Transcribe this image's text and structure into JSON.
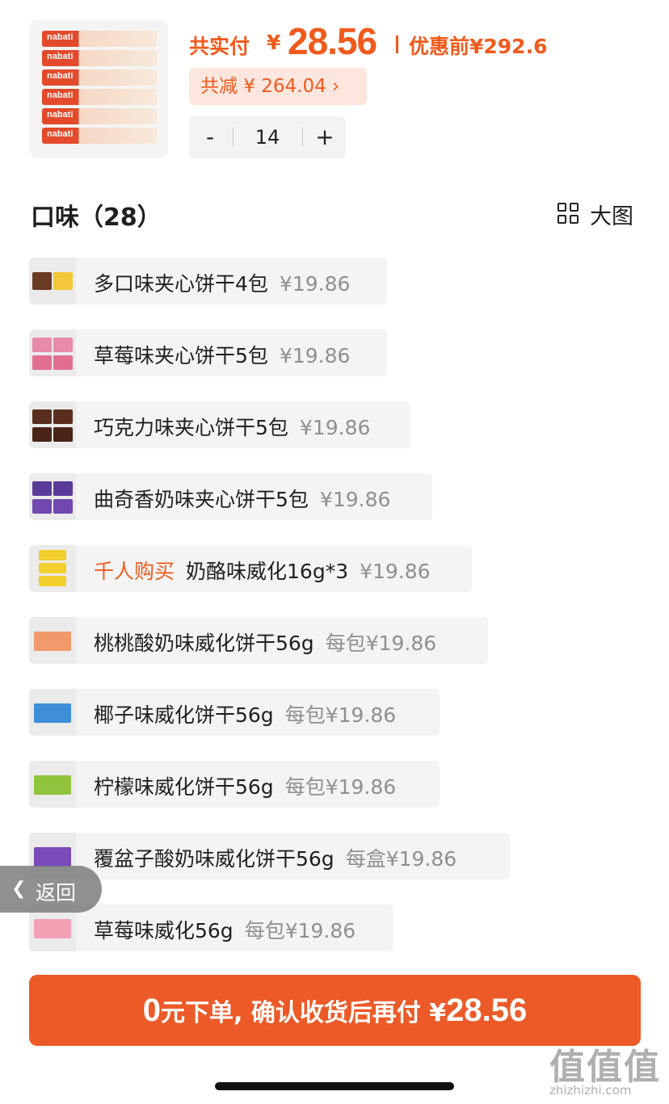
{
  "header": {
    "paid_label": "共实付",
    "currency": "¥",
    "paid_amount": "28.56",
    "original_label": "优惠前¥292.6",
    "discount_label": "共减 ¥ 264.04 ›",
    "quantity": "14",
    "minus_label": "-",
    "plus_label": "+",
    "product_brand": "nabati"
  },
  "section": {
    "title": "口味（28）",
    "view_label": "大图"
  },
  "options": [
    {
      "name": "多口味夹心饼干4包",
      "price": "¥19.86"
    },
    {
      "name": "草莓味夹心饼干5包",
      "price": "¥19.86"
    },
    {
      "name": "巧克力味夹心饼干5包",
      "price": "¥19.86"
    },
    {
      "name": "曲奇香奶味夹心饼干5包",
      "price": "¥19.86"
    },
    {
      "tag": "千人购买",
      "name": "奶酪味威化16g*3",
      "price": "¥19.86"
    },
    {
      "name": "桃桃酸奶味威化饼干56g",
      "price": "每包¥19.86"
    },
    {
      "name": "椰子味威化饼干56g",
      "price": "每包¥19.86"
    },
    {
      "name": "柠檬味威化饼干56g",
      "price": "每包¥19.86"
    },
    {
      "name": "覆盆子酸奶味威化饼干56g",
      "price": "每盒¥19.86"
    },
    {
      "name": "草莓味威化56g",
      "price": "每包¥19.86"
    }
  ],
  "back": {
    "label": "返回"
  },
  "cta": {
    "zero": "0",
    "text": "元下单, 确认收货后再付 ¥",
    "amount": "28.56"
  },
  "watermark": {
    "big": "值值值",
    "small": "zhizhizhi.com"
  },
  "colors": {
    "accent": "#f05a1c",
    "cta_bg": "#ec5a27",
    "discount_bg": "#fde6de",
    "option_bg": "#f4f4f4",
    "muted_text": "#8f8f8f"
  }
}
